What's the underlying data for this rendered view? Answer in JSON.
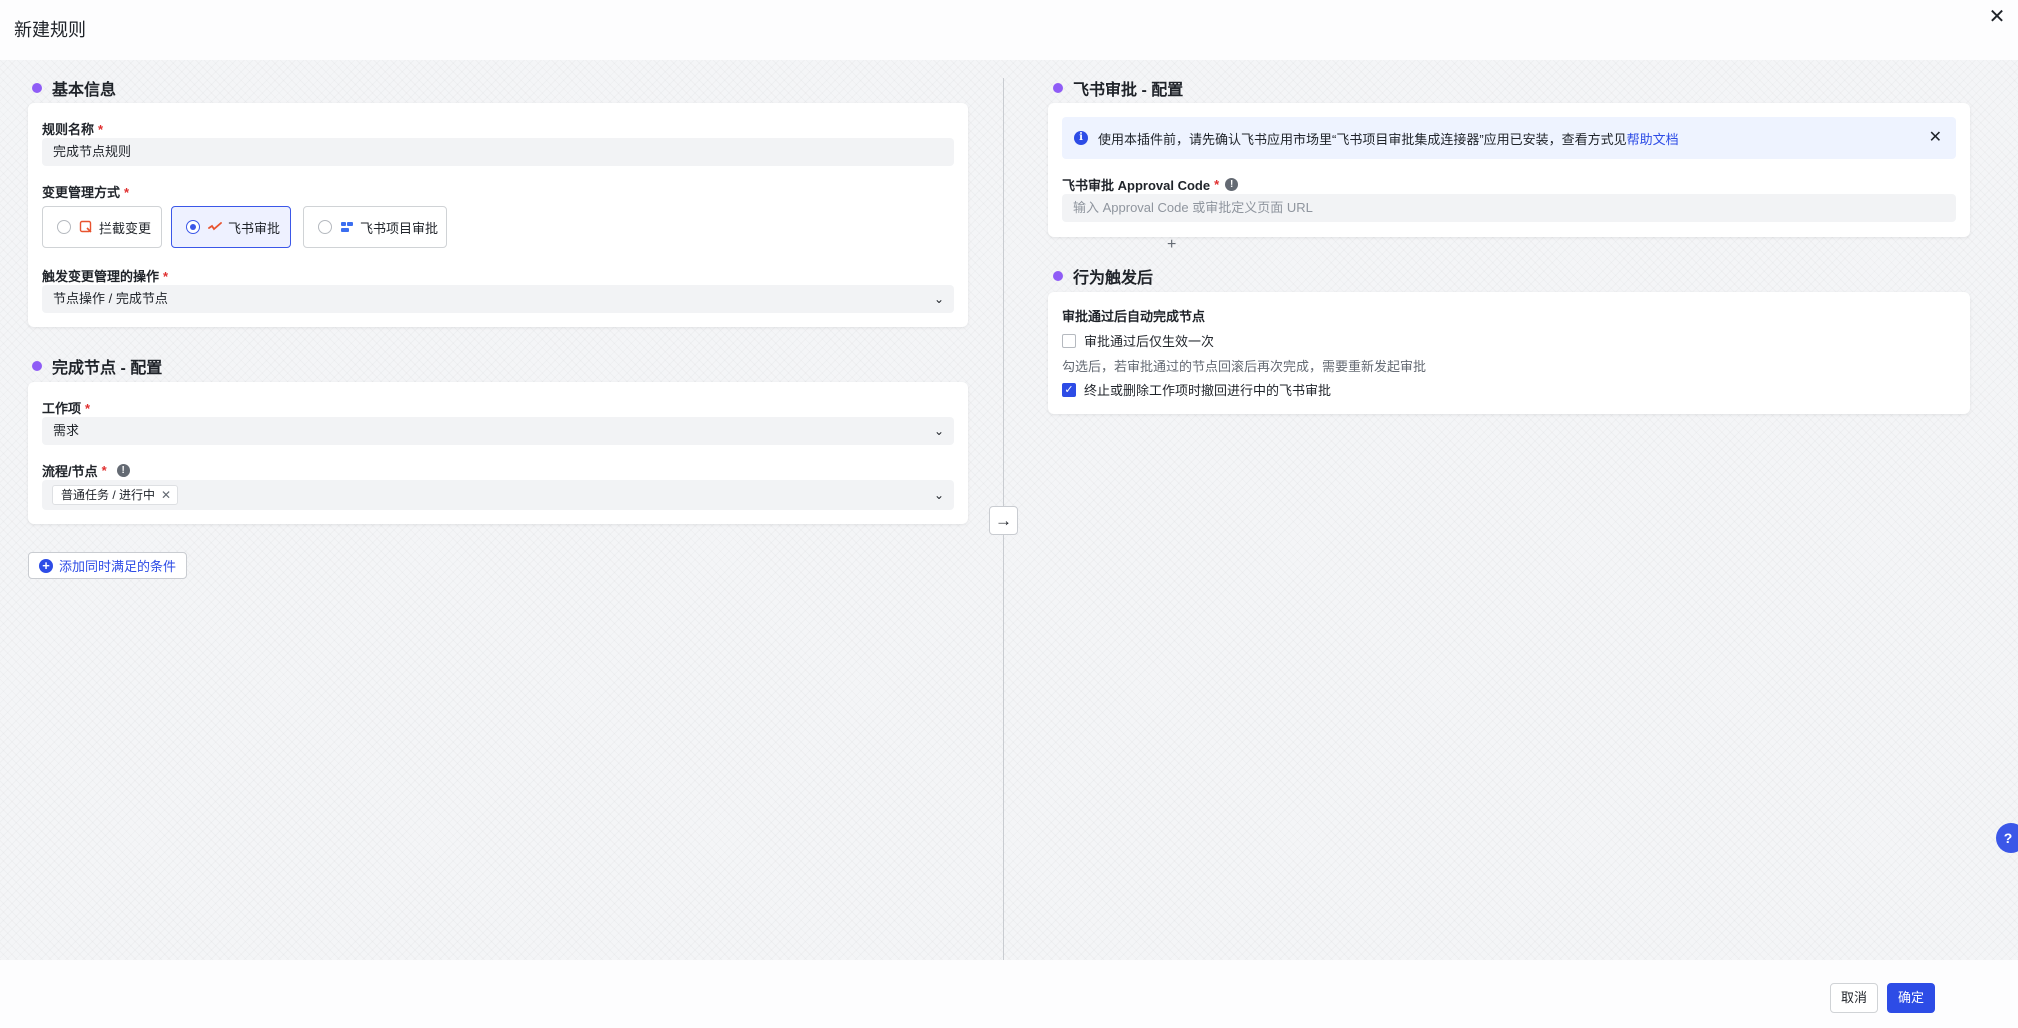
{
  "header": {
    "title": "新建规则"
  },
  "footer": {
    "cancel_label": "取消",
    "ok_label": "确定"
  },
  "left": {
    "basic": {
      "section_title": "基本信息",
      "rule_name_label": "规则名称",
      "rule_name_value": "完成节点规则",
      "mode_label": "变更管理方式",
      "options": [
        {
          "label": "拦截变更",
          "icon": "intercept-icon",
          "selected": false
        },
        {
          "label": "飞书审批",
          "icon": "feishu-approval-icon",
          "selected": true
        },
        {
          "label": "飞书项目审批",
          "icon": "feishu-project-icon",
          "selected": false
        }
      ],
      "trigger_label": "触发变更管理的操作",
      "trigger_value": "节点操作 / 完成节点"
    },
    "complete": {
      "section_title": "完成节点 - 配置",
      "workitem_label": "工作项",
      "workitem_value": "需求",
      "flow_label": "流程/节点",
      "flow_tag": "普通任务 / 进行中"
    },
    "add_condition_label": "添加同时满足的条件"
  },
  "right": {
    "feishu": {
      "section_title": "飞书审批 - 配置",
      "alert_text": "使用本插件前，请先确认飞书应用市场里“飞书项目审批集成连接器”应用已安装，查看方式见",
      "alert_link": "帮助文档",
      "approval_label": "飞书审批 Approval Code",
      "approval_placeholder": "输入 Approval Code 或审批定义页面 URL"
    },
    "after": {
      "section_title": "行为触发后",
      "subtitle": "审批通过后自动完成节点",
      "checkbox1_label": "审批通过后仅生效一次",
      "checkbox1_checked": false,
      "hint": "勾选后，若审批通过的节点回滚后再次完成，需要重新发起审批",
      "checkbox2_label": "终止或删除工作项时撤回进行中的飞书审批",
      "checkbox2_checked": true
    }
  },
  "colors": {
    "accent": "#2d4ce6",
    "section_dot": "#8f5cf6",
    "required": "#e02e2e"
  }
}
